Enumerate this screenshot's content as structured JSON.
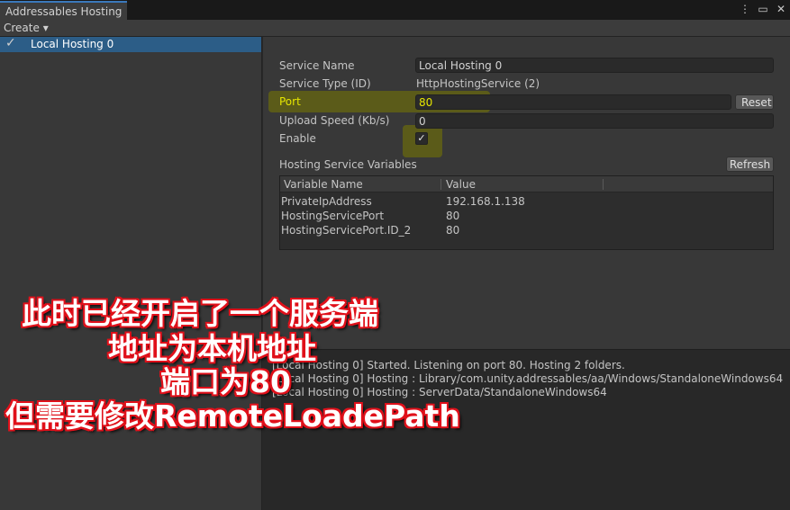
{
  "window": {
    "tab_title": "Addressables Hosting",
    "menu_icon": "⋮",
    "maximize_icon": "▭",
    "close_icon": "✕"
  },
  "toolbar": {
    "create_label": "Create ▾"
  },
  "services_list": {
    "items": [
      {
        "label": "Local Hosting 0",
        "check": "✓"
      }
    ]
  },
  "service": {
    "name_label": "Service Name",
    "name_value": "Local Hosting 0",
    "type_label": "Service Type (ID)",
    "type_value": "HttpHostingService (2)",
    "port_label": "Port",
    "port_value": "80",
    "reset_label": "Reset",
    "upload_label": "Upload Speed (Kb/s)",
    "upload_value": "0",
    "enable_label": "Enable",
    "enable_check": "✓"
  },
  "variables": {
    "title": "Hosting Service Variables",
    "refresh_label": "Refresh",
    "columns": [
      "Variable Name",
      "Value"
    ],
    "rows": [
      {
        "name": "PrivateIpAddress",
        "value": "192.168.1.138"
      },
      {
        "name": "HostingServicePort",
        "value": "80"
      },
      {
        "name": "HostingServicePort.ID_2",
        "value": "80"
      }
    ]
  },
  "log": {
    "lines": [
      "[Local Hosting 0] Started. Listening on port 80. Hosting 2 folders.",
      "[Local Hosting 0] Hosting : Library/com.unity.addressables/aa/Windows/StandaloneWindows64",
      "[Local Hosting 0] Hosting : ServerData/StandaloneWindows64"
    ]
  },
  "annotation": {
    "line1": "此时已经开启了一个服务端",
    "line2": "地址为本机地址",
    "line3": "端口为80",
    "line4": "但需要修改RemoteLoadePath"
  },
  "colors": {
    "selection": "#2c5d87",
    "port_highlight": "#78780a",
    "annotation_outline": "#e0101a"
  }
}
